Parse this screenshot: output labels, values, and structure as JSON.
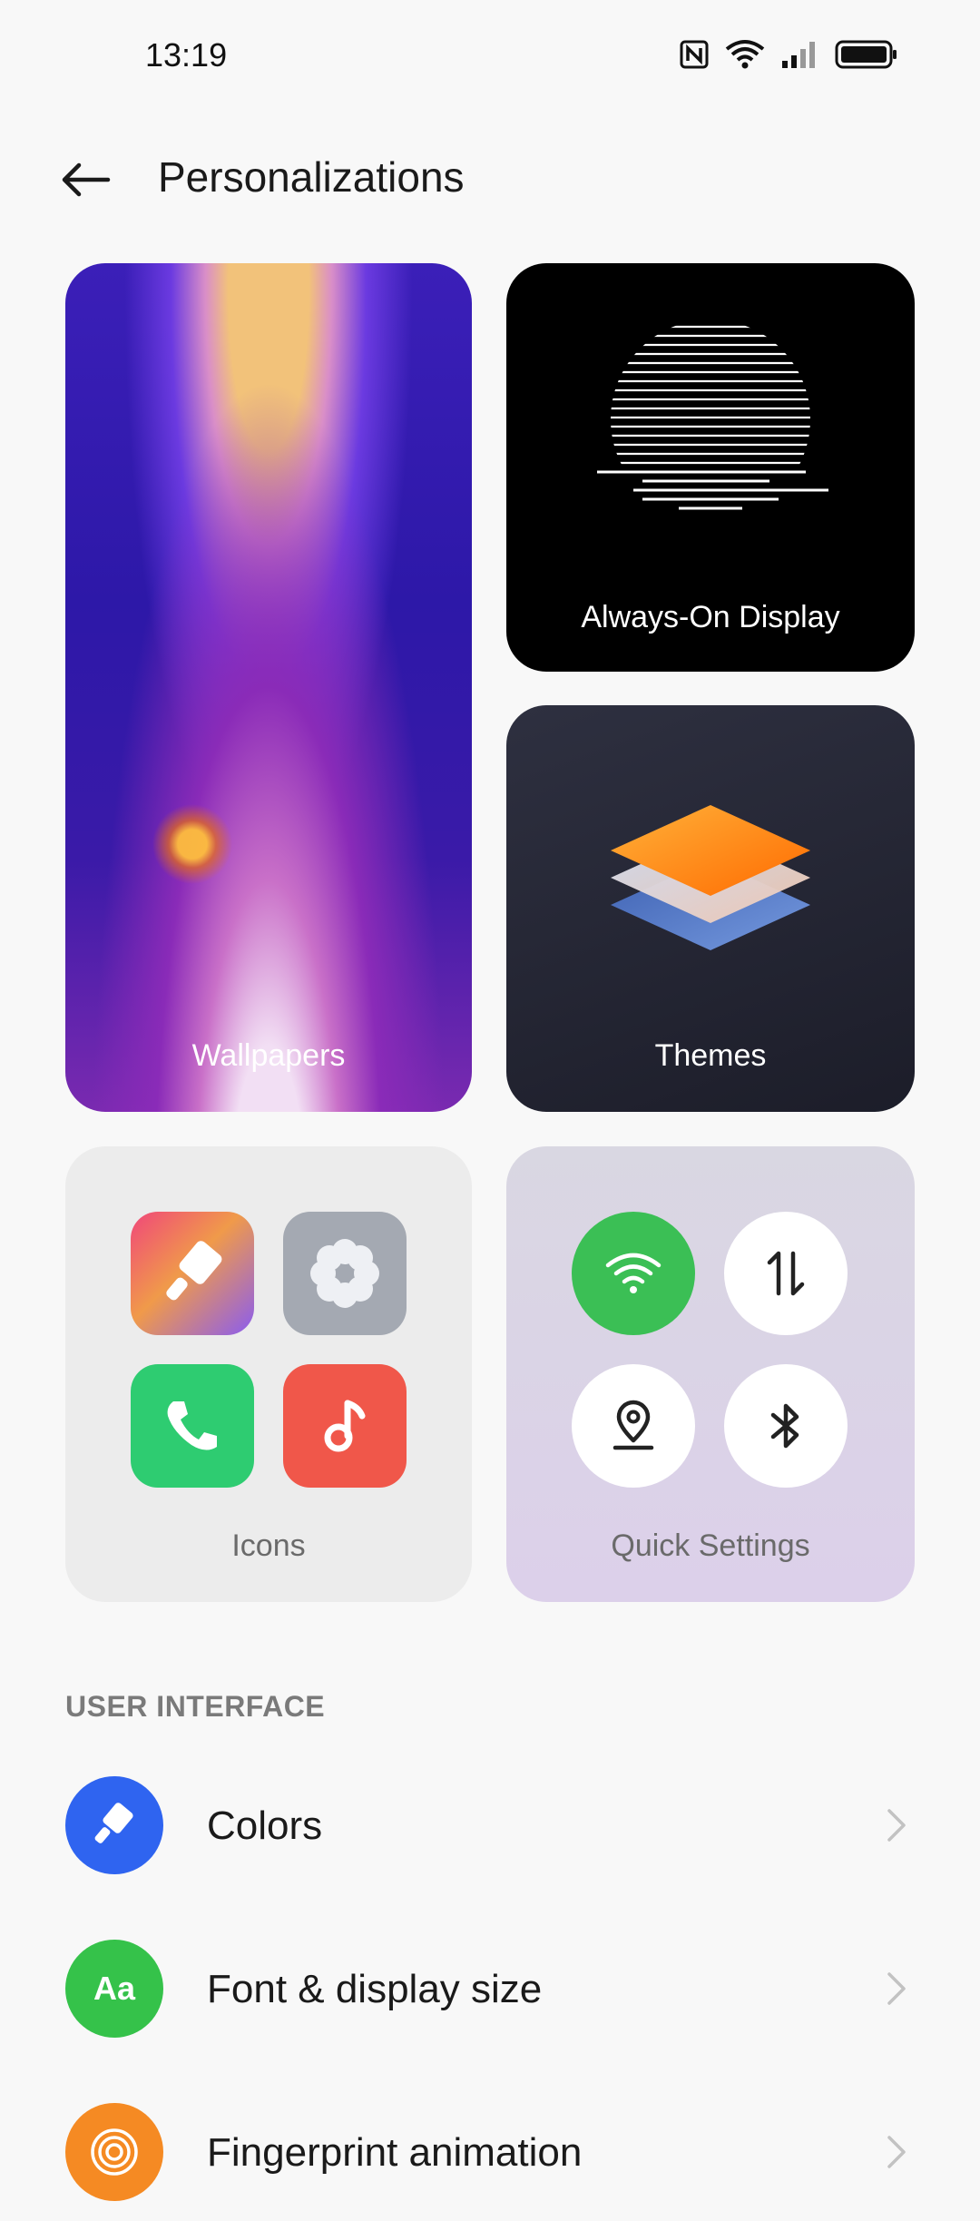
{
  "status_bar": {
    "time": "13:19",
    "icons": [
      "nfc-icon",
      "wifi-icon",
      "signal-icon",
      "battery-icon"
    ]
  },
  "header": {
    "title": "Personalizations",
    "back_icon": "back-arrow-icon"
  },
  "cards": {
    "wallpapers": "Wallpapers",
    "always_on_display": "Always-On Display",
    "themes": "Themes",
    "icons": "Icons",
    "quick_settings": "Quick Settings"
  },
  "icons_preview": [
    "brush-app-icon",
    "settings-app-icon",
    "phone-app-icon",
    "music-app-icon"
  ],
  "quick_settings_preview": [
    "wifi-toggle-icon",
    "data-toggle-icon",
    "location-toggle-icon",
    "bluetooth-toggle-icon"
  ],
  "section": {
    "title": "USER INTERFACE",
    "items": [
      {
        "label": "Colors",
        "icon": "colors-icon",
        "color": "#2f64f0"
      },
      {
        "label": "Font & display size",
        "icon": "font-icon",
        "color": "#35c24a",
        "icon_text": "Aa"
      },
      {
        "label": "Fingerprint animation",
        "icon": "fingerprint-icon",
        "color": "#f58a23"
      }
    ]
  },
  "colors": {
    "background": "#f8f8f8",
    "qs_active": "#3bbf55"
  }
}
